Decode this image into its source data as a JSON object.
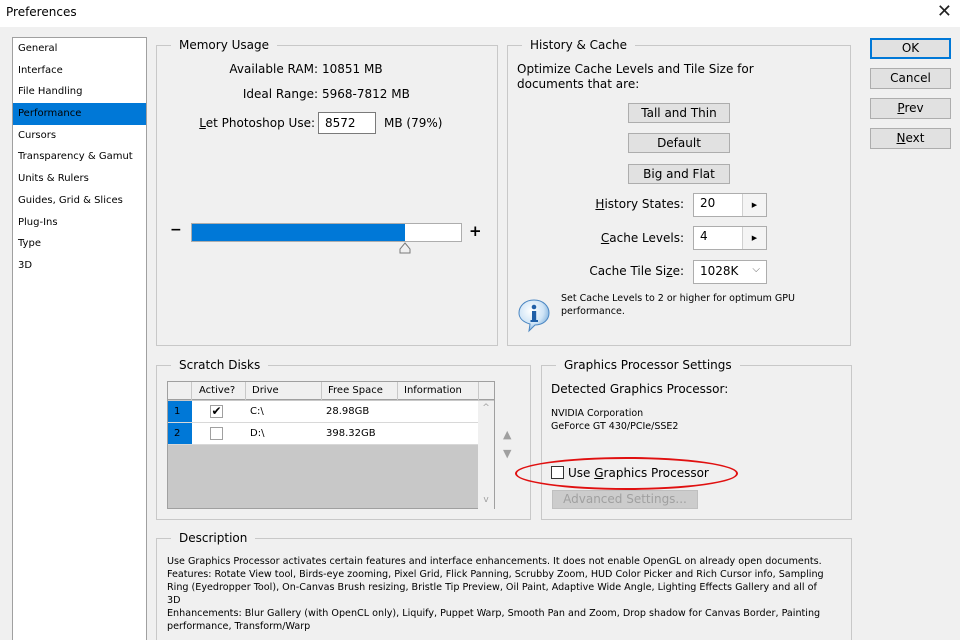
{
  "window": {
    "title": "Preferences",
    "close_icon": "close-icon"
  },
  "sidebar": {
    "items": [
      {
        "label": "General"
      },
      {
        "label": "Interface"
      },
      {
        "label": "File Handling"
      },
      {
        "label": "Performance",
        "selected": true
      },
      {
        "label": "Cursors"
      },
      {
        "label": "Transparency & Gamut"
      },
      {
        "label": "Units & Rulers"
      },
      {
        "label": "Guides, Grid & Slices"
      },
      {
        "label": "Plug-Ins"
      },
      {
        "label": "Type"
      },
      {
        "label": "3D"
      }
    ]
  },
  "memory": {
    "legend": "Memory Usage",
    "available_label": "Available RAM:",
    "available_value": "10851 MB",
    "ideal_label": "Ideal Range:",
    "ideal_value": "5968-7812 MB",
    "use_label_u": "L",
    "use_label_rest": "et Photoshop Use:",
    "use_value": "8572",
    "use_suffix": "MB (79%)",
    "slider_percent": 79,
    "minus": "−",
    "plus": "+"
  },
  "history_cache": {
    "legend": "History & Cache",
    "intro": "Optimize Cache Levels and Tile Size for documents that are:",
    "intro_line1": "Optimize Cache Levels and Tile Size for",
    "intro_line2": "documents that are:",
    "buttons": [
      "Tall and Thin",
      "Default",
      "Big and Flat"
    ],
    "history_states_label_u": "H",
    "history_states_label_rest": "istory States:",
    "history_states_value": "20",
    "cache_levels_label_u": "C",
    "cache_levels_label_rest": "ache Levels:",
    "cache_levels_value": "4",
    "tile_size_label_pre": "Cache Tile Si",
    "tile_size_label_u": "z",
    "tile_size_label_post": "e:",
    "tile_size_value": "1028K",
    "spin_arrow": "▶",
    "chevron": "⌵",
    "info_line1": "Set Cache Levels to 2 or higher for optimum GPU",
    "info_line2": "performance."
  },
  "dialog_buttons": {
    "ok": "OK",
    "cancel": "Cancel",
    "prev_u": "P",
    "prev_rest": "rev",
    "next_u": "N",
    "next_rest": "ext"
  },
  "scratch_disks": {
    "legend": "Scratch Disks",
    "columns": [
      "",
      "Active?",
      "Drive",
      "Free Space",
      "Information"
    ],
    "rows": [
      {
        "num": "1",
        "active": true,
        "drive": "C:\\",
        "free_space": "28.98GB",
        "information": ""
      },
      {
        "num": "2",
        "active": false,
        "drive": "D:\\",
        "free_space": "398.32GB",
        "information": ""
      }
    ],
    "check_mark": "✔",
    "scroll_up": "^",
    "scroll_down": "v",
    "move_up": "▲",
    "move_down": "▼"
  },
  "gpu": {
    "legend": "Graphics Processor Settings",
    "detected_label": "Detected Graphics Processor:",
    "vendor": "NVIDIA Corporation",
    "model": "GeForce GT 430/PCIe/SSE2",
    "use_gpu_pre": "Use ",
    "use_gpu_u": "G",
    "use_gpu_post": "raphics Processor",
    "use_gpu_checked": false,
    "advanced_button": "Advanced Settings..."
  },
  "description": {
    "legend": "Description",
    "lines": [
      "Use Graphics Processor activates certain features and interface enhancements. It does not enable OpenGL on already open documents.",
      "Features: Rotate View tool, Birds-eye zooming, Pixel Grid, Flick Panning, Scrubby Zoom, HUD Color Picker and Rich Cursor info, Sampling",
      "Ring (Eyedropper Tool), On-Canvas Brush resizing, Bristle Tip Preview, Oil Paint, Adaptive Wide Angle, Lighting Effects Gallery and all of",
      "3D",
      "Enhancements: Blur Gallery (with OpenCL only), Liquify, Puppet Warp, Smooth Pan and Zoom, Drop shadow for Canvas Border, Painting",
      "performance, Transform/Warp"
    ]
  },
  "colors": {
    "accent": "#0078d7",
    "annotation": "#e01010"
  }
}
